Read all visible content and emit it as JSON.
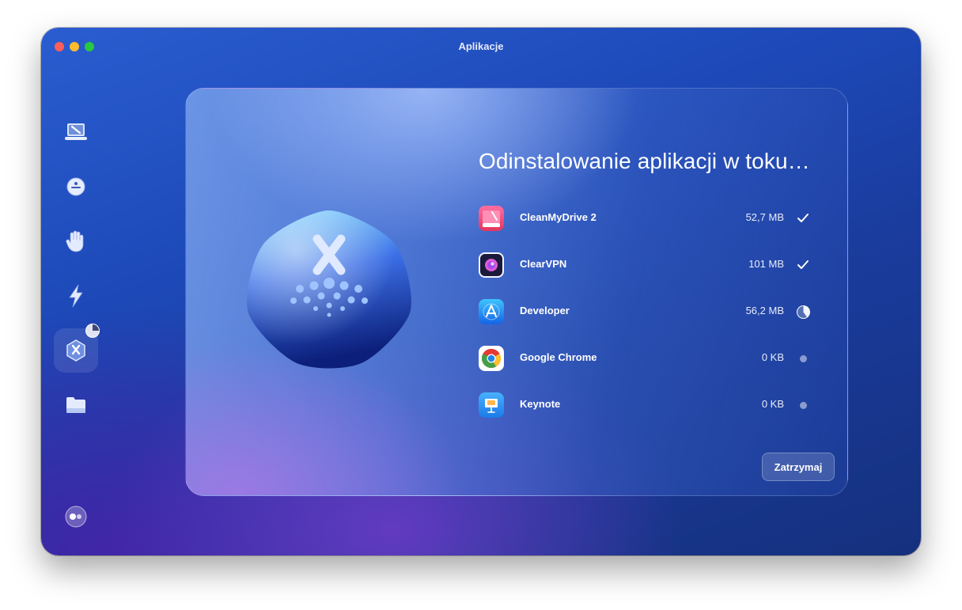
{
  "window": {
    "title": "Aplikacje"
  },
  "sidebar": {
    "items": [
      {
        "icon": "laptop-sweep-icon"
      },
      {
        "icon": "shield-ball-icon"
      },
      {
        "icon": "hand-icon"
      },
      {
        "icon": "lightning-icon"
      },
      {
        "icon": "applications-icon",
        "active": true,
        "progress_fraction": 0.25
      },
      {
        "icon": "folder-icon"
      }
    ],
    "bottom_icon": "assistant-toggle-icon"
  },
  "main": {
    "heading": "Odinstalowanie aplikacji w toku…",
    "apps": [
      {
        "name": "CleanMyDrive 2",
        "size": "52,7 MB",
        "status": "done",
        "icon": "cleanmydrive-icon"
      },
      {
        "name": "ClearVPN",
        "size": "101 MB",
        "status": "done",
        "icon": "clearvpn-icon"
      },
      {
        "name": "Developer",
        "size": "56,2 MB",
        "status": "in-progress",
        "progress_fraction": 0.4,
        "icon": "developer-icon"
      },
      {
        "name": "Google Chrome",
        "size": "0 KB",
        "status": "pending",
        "icon": "chrome-icon"
      },
      {
        "name": "Keynote",
        "size": "0 KB",
        "status": "pending",
        "icon": "keynote-icon"
      }
    ],
    "stop_button": "Zatrzymaj"
  },
  "colors": {
    "window_gradient_top": "#2a5dd0",
    "window_gradient_bottom": "#15307d",
    "accent_purple": "#6e3cc8",
    "text_primary": "#ffffff"
  }
}
